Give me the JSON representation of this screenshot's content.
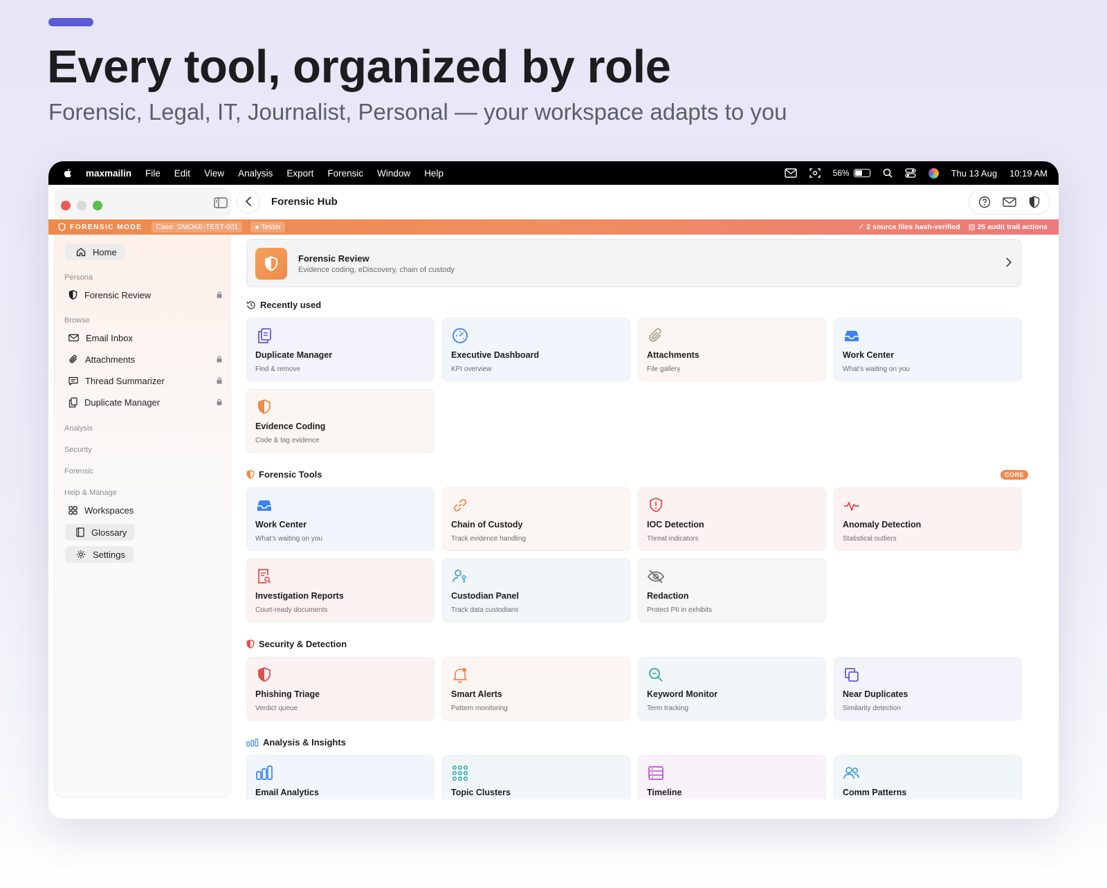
{
  "hero": {
    "headline": "Every tool, organized by role",
    "subheadline": "Forensic, Legal, IT, Journalist, Personal — your workspace adapts to you"
  },
  "menubar": {
    "app_name": "maxmailin",
    "items": [
      "File",
      "Edit",
      "View",
      "Analysis",
      "Export",
      "Forensic",
      "Window",
      "Help"
    ],
    "battery": "56%",
    "battery_level": 0.56,
    "date": "Thu 13 Aug",
    "time": "10:19 AM"
  },
  "window": {
    "title": "Forensic Hub"
  },
  "banner": {
    "mode": "FORENSIC MODE",
    "case": "Case: SMOKE-TEST-001",
    "user": "Tester",
    "hash_status": "2 source files hash-verified",
    "audit": "25 audit trail actions",
    "color_start": "#ee8a4c",
    "color_end": "#ec7a7a"
  },
  "sidebar": {
    "home": "Home",
    "persona_header": "Persona",
    "persona_item": "Forensic Review",
    "browse_header": "Browse",
    "browse_items": [
      "Email Inbox",
      "Attachments",
      "Thread Summarizer",
      "Duplicate Manager"
    ],
    "analysis_header": "Analysis",
    "security_header": "Security",
    "forensic_header": "Forensic",
    "help_header": "Help & Manage",
    "workspaces": "Workspaces",
    "glossary": "Glossary",
    "settings": "Settings"
  },
  "persona_card": {
    "title": "Forensic Review",
    "subtitle": "Evidence coding, eDiscovery, chain of custody"
  },
  "sections": {
    "recent": {
      "title": "Recently used",
      "cards": [
        {
          "title": "Duplicate Manager",
          "subtitle": "Find & remove",
          "icon": "documents-icon"
        },
        {
          "title": "Executive Dashboard",
          "subtitle": "KPI overview",
          "icon": "gauge-icon"
        },
        {
          "title": "Attachments",
          "subtitle": "File gallery",
          "icon": "paperclip-icon"
        },
        {
          "title": "Work Center",
          "subtitle": "What's waiting on you",
          "icon": "inbox-tray-icon"
        },
        {
          "title": "Evidence Coding",
          "subtitle": "Code & tag evidence",
          "icon": "shield-icon"
        }
      ]
    },
    "forensic": {
      "title": "Forensic Tools",
      "badge": "CORE",
      "cards": [
        {
          "title": "Work Center",
          "subtitle": "What's waiting on you",
          "icon": "inbox-tray-icon"
        },
        {
          "title": "Chain of Custody",
          "subtitle": "Track evidence handling",
          "icon": "link-icon"
        },
        {
          "title": "IOC Detection",
          "subtitle": "Threat indicators",
          "icon": "shield-alert-icon"
        },
        {
          "title": "Anomaly Detection",
          "subtitle": "Statistical outliers",
          "icon": "pulse-icon"
        },
        {
          "title": "Investigation Reports",
          "subtitle": "Court-ready documents",
          "icon": "report-search-icon"
        },
        {
          "title": "Custodian Panel",
          "subtitle": "Track data custodians",
          "icon": "user-key-icon"
        },
        {
          "title": "Redaction",
          "subtitle": "Protect PII in exhibits",
          "icon": "eye-off-icon"
        }
      ]
    },
    "security": {
      "title": "Security & Detection",
      "cards": [
        {
          "title": "Phishing Triage",
          "subtitle": "Verdict queue",
          "icon": "shield-half-icon"
        },
        {
          "title": "Smart Alerts",
          "subtitle": "Pattern monitoring",
          "icon": "bell-icon"
        },
        {
          "title": "Keyword Monitor",
          "subtitle": "Term tracking",
          "icon": "magnifier-icon"
        },
        {
          "title": "Near Duplicates",
          "subtitle": "Similarity detection",
          "icon": "copy-icon"
        }
      ]
    },
    "analysis": {
      "title": "Analysis & Insights",
      "cards": [
        {
          "title": "Email Analytics",
          "icon": "bar-chart-icon"
        },
        {
          "title": "Topic Clusters",
          "icon": "dot-grid-icon"
        },
        {
          "title": "Timeline",
          "icon": "timeline-icon"
        },
        {
          "title": "Comm Patterns",
          "icon": "users-icon"
        }
      ]
    }
  }
}
